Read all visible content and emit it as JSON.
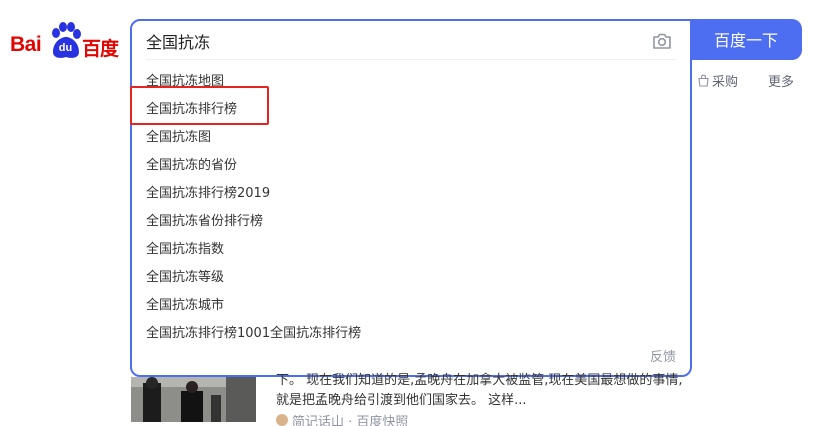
{
  "logo": {
    "bai": "Bai",
    "du": "du",
    "cn": "百度"
  },
  "search": {
    "query": "全国抗冻",
    "button_label": "百度一下",
    "feedback": "反馈",
    "suggestions": [
      "全国抗冻地图",
      "全国抗冻排行榜",
      "全国抗冻图",
      "全国抗冻的省份",
      "全国抗冻排行榜2019",
      "全国抗冻省份排行榜",
      "全国抗冻指数",
      "全国抗冻等级",
      "全国抗冻城市",
      "全国抗冻排行榜1001全国抗冻排行榜"
    ]
  },
  "tabs": {
    "purchase": "采购",
    "more": "更多"
  },
  "result": {
    "line1": "下。 现在我们知道的是,孟晚舟在加拿大被监管,现在美国最想做的事情,",
    "line2": "就是把孟晚舟给引渡到他们国家去。 这样...",
    "source": "简记话山 · 百度快照"
  },
  "colors": {
    "brand_blue": "#4e6ef2",
    "logo_red": "#e10601",
    "highlight_red": "#e5231f"
  },
  "icons": {
    "camera": "camera-icon",
    "purchase": "bag-icon"
  }
}
